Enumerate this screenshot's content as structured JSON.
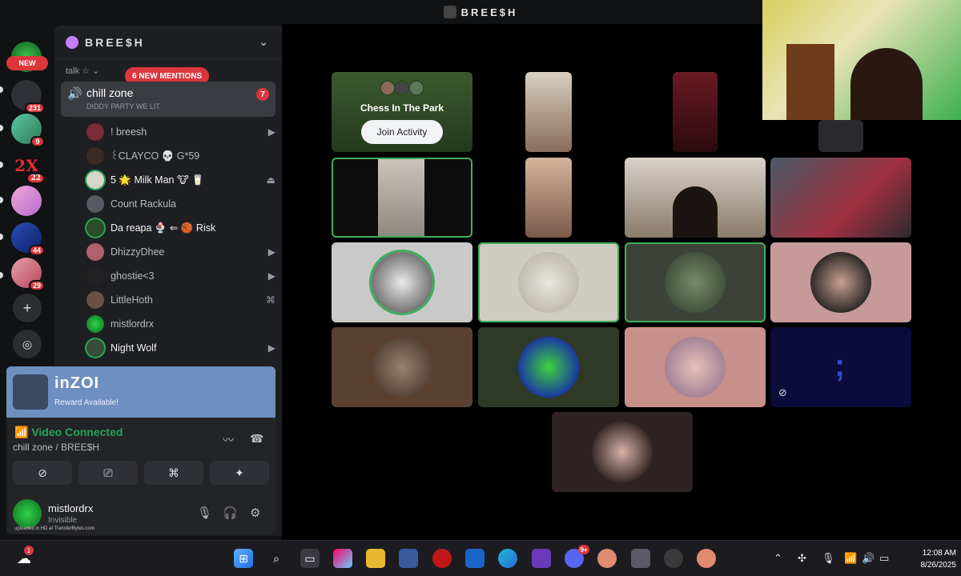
{
  "window": {
    "title": "BREE$H"
  },
  "rail": {
    "new_label": "NEW",
    "servers": [
      {
        "name": "server-1",
        "badge": ""
      },
      {
        "name": "server-2",
        "badge": "231"
      },
      {
        "name": "server-3",
        "badge": "9"
      },
      {
        "name": "server-4",
        "badge": "22"
      },
      {
        "name": "server-5",
        "badge": ""
      },
      {
        "name": "server-6",
        "badge": "44"
      },
      {
        "name": "server-7",
        "badge": "29"
      }
    ],
    "add_label": "+",
    "discover_label": "◎"
  },
  "sidebar": {
    "guild_name": "BREE$H",
    "category": "talk ☆ ⌄",
    "mentions_pill": "6 NEW MENTIONS",
    "channel": {
      "name": "chill zone",
      "status": "DIDDY PARTY WE LIT",
      "badge": "7"
    },
    "members": [
      {
        "name": "! breesh",
        "icon": "video-icon",
        "bright": false
      },
      {
        "name": "꒰CLAYCO 💀 G*59",
        "icon": "",
        "bright": false
      },
      {
        "name": "5 🌟 Milk Man 🐮 🥛",
        "icon": "playstation-icon",
        "bright": true
      },
      {
        "name": "Count Rackula",
        "icon": "",
        "bright": false
      },
      {
        "name": "Da reapa 🍨 ⇐ 🏀 Risk",
        "icon": "",
        "bright": true
      },
      {
        "name": "DhizzyDhee",
        "icon": "video-icon",
        "bright": false
      },
      {
        "name": "ghostie<3",
        "icon": "video-icon",
        "bright": false
      },
      {
        "name": "LittleHoth",
        "icon": "gamepad-icon",
        "bright": false
      },
      {
        "name": "mistlordrx",
        "icon": "",
        "bright": false
      },
      {
        "name": "Night Wolf",
        "icon": "video-icon",
        "bright": true
      }
    ]
  },
  "promo": {
    "title": "inZOI",
    "subtitle": "Reward Available!"
  },
  "voice": {
    "status": "Video Connected",
    "location": "chill zone / BREE$H"
  },
  "user": {
    "name": "mistlordrx",
    "status": "Invisible"
  },
  "activity": {
    "title": "Chess In The Park",
    "button": "Join Activity"
  },
  "taskbar": {
    "weather_badge": "1",
    "discord_badge": "9+",
    "time": "12:08 AM",
    "date": "8/26/2025"
  },
  "watermark": "uploaded in HD at TransferBytes.com",
  "colors": {
    "accent": "#23a55a",
    "danger": "#da373c",
    "sidebar": "#1e1f22"
  }
}
